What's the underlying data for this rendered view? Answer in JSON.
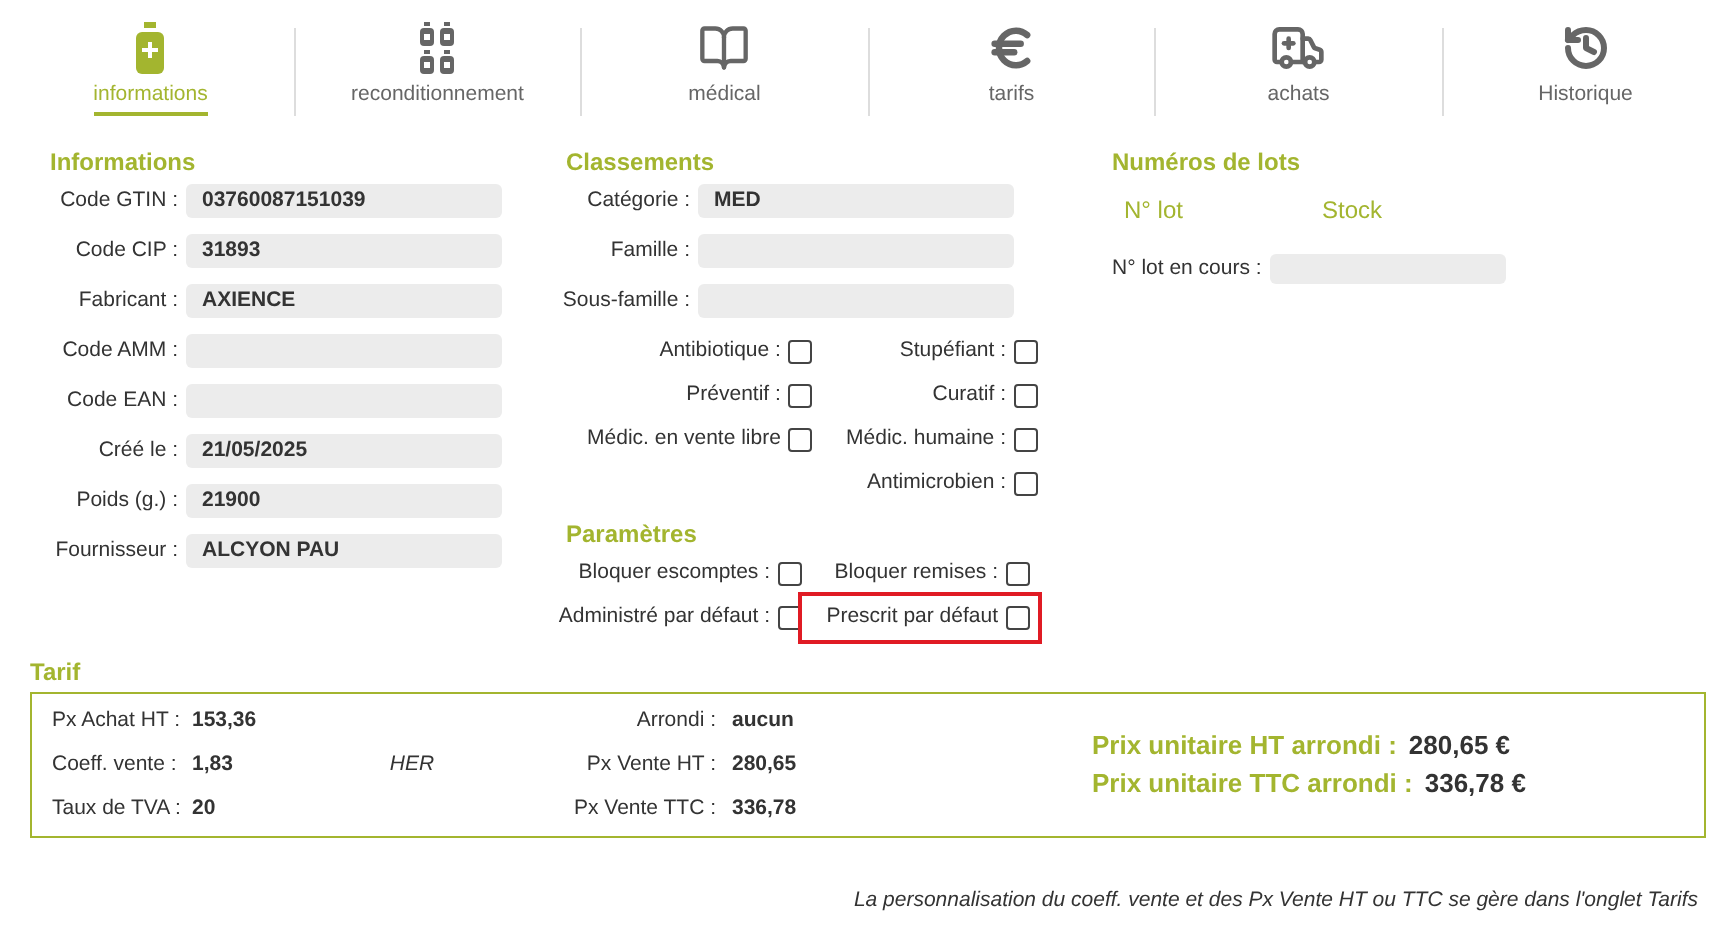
{
  "tabs": [
    {
      "label": "informations",
      "kind": "bottle",
      "selected": true
    },
    {
      "label": "reconditionnement",
      "kind": "bottles",
      "selected": false
    },
    {
      "label": "médical",
      "kind": "book",
      "selected": false
    },
    {
      "label": "tarifs",
      "kind": "euro",
      "selected": false
    },
    {
      "label": "achats",
      "kind": "ambulance",
      "selected": false
    },
    {
      "label": "Historique",
      "kind": "history",
      "selected": false
    }
  ],
  "informations": {
    "title": "Informations",
    "fields": [
      {
        "label": "Code GTIN :",
        "value": "03760087151039"
      },
      {
        "label": "Code CIP :",
        "value": "31893"
      },
      {
        "label": "Fabricant :",
        "value": "AXIENCE"
      },
      {
        "label": "Code AMM :"
      },
      {
        "label": "Code EAN :"
      },
      {
        "label": "Créé le :",
        "value": "21/05/2025"
      },
      {
        "label": "Poids (g.) :",
        "value": "21900"
      },
      {
        "label": "Fournisseur :",
        "value": "ALCYON PAU"
      }
    ]
  },
  "classements": {
    "title": "Classements",
    "fields": [
      {
        "label": "Catégorie :",
        "value": "MED"
      },
      {
        "label": "Famille :"
      },
      {
        "label": "Sous-famille :"
      }
    ],
    "checkbox_rows": [
      [
        {
          "label": "Antibiotique :",
          "checked": false
        },
        {
          "label": "Stupéfiant :",
          "checked": false
        }
      ],
      [
        {
          "label": "Préventif :",
          "checked": false
        },
        {
          "label": "Curatif :",
          "checked": false
        }
      ],
      [
        {
          "label": "Médic. en vente libre",
          "checked": false
        },
        {
          "label": "Médic. humaine :",
          "checked": false
        }
      ],
      [
        {
          "label": "Antimicrobien :",
          "checked": false
        }
      ]
    ]
  },
  "parametres": {
    "title": "Paramètres",
    "checkbox_rows": [
      [
        {
          "label": "Bloquer escomptes :",
          "checked": false,
          "highlighted": false
        },
        {
          "label": "Bloquer remises :",
          "checked": false,
          "highlighted": false
        }
      ],
      [
        {
          "label": "Administré par défaut :",
          "checked": false,
          "highlighted": false
        },
        {
          "label": "Prescrit par défaut",
          "checked": false,
          "highlighted": true
        }
      ]
    ]
  },
  "lots": {
    "title": "Numéros de lots",
    "columns": [
      "N° lot",
      "Stock"
    ],
    "current_label": "N° lot en cours :"
  },
  "tarif": {
    "title": "Tarif",
    "rows": [
      {
        "left": {
          "label": "Px Achat HT :",
          "value": "153,36"
        },
        "right": {
          "label": "Arrondi :",
          "value": "aucun"
        }
      },
      {
        "left": {
          "label": "Coeff. vente :",
          "value": "1,83"
        },
        "note": "HER",
        "right": {
          "label": "Px Vente HT :",
          "value": "280,65"
        }
      },
      {
        "left": {
          "label": "Taux de TVA :",
          "value": "20"
        },
        "right": {
          "label": "Px Vente TTC :",
          "value": "336,78"
        }
      }
    ],
    "totals": [
      {
        "label": "Prix unitaire HT arrondi :",
        "value": "280,65 €"
      },
      {
        "label": "Prix unitaire TTC arrondi :",
        "value": "336,78 €"
      }
    ]
  },
  "footer_note": "La personnalisation du coeff. vente et des Px Vente HT ou TTC se gère dans l'onglet Tarifs"
}
